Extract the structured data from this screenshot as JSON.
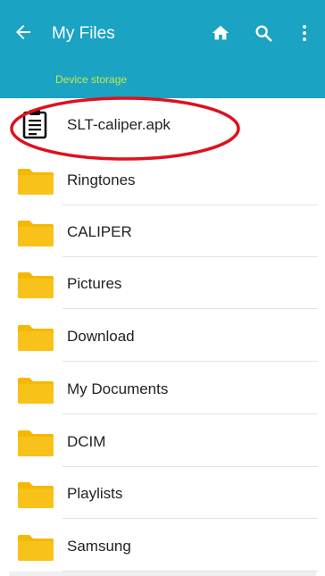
{
  "header": {
    "title": "My Files",
    "breadcrumb": "Device storage",
    "icons": {
      "back": "arrow-left-icon",
      "home": "home-icon",
      "search": "search-icon",
      "more": "more-vert-icon"
    }
  },
  "colors": {
    "appbar": "#1aa3c2",
    "breadcrumb": "#c6e84a",
    "folder": "#f5b800",
    "highlight": "#e0101c"
  },
  "files": [
    {
      "label": "SLT-caliper.apk",
      "type": "apk",
      "icon": "clipboard-file-icon"
    },
    {
      "label": "Ringtones",
      "type": "folder",
      "icon": "folder-icon"
    },
    {
      "label": "CALIPER",
      "type": "folder",
      "icon": "folder-icon"
    },
    {
      "label": "Pictures",
      "type": "folder",
      "icon": "folder-icon"
    },
    {
      "label": "Download",
      "type": "folder",
      "icon": "folder-icon"
    },
    {
      "label": "My Documents",
      "type": "folder",
      "icon": "folder-icon"
    },
    {
      "label": "DCIM",
      "type": "folder",
      "icon": "folder-icon"
    },
    {
      "label": "Playlists",
      "type": "folder",
      "icon": "folder-icon"
    },
    {
      "label": "Samsung",
      "type": "folder",
      "icon": "folder-icon"
    }
  ]
}
